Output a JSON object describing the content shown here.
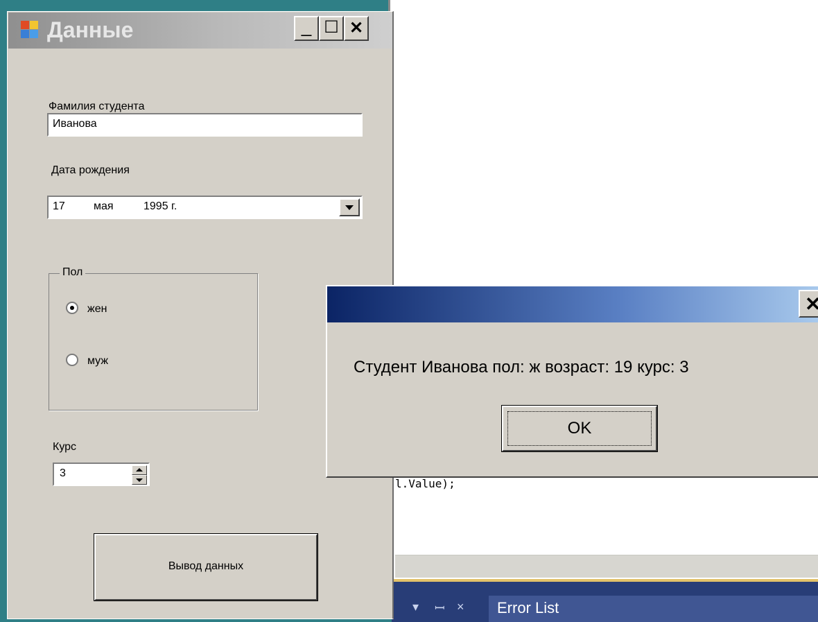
{
  "editor": {
    "code_fragment": "l.Value);"
  },
  "error_panel": {
    "tab_label": "Error List",
    "dropdown_glyph": "▾",
    "pin_glyph": "ꟷ",
    "close_glyph": "×"
  },
  "form": {
    "title": "Данные",
    "icon": "app-form-icon",
    "minimize_glyph": "_",
    "maximize_glyph": "☐",
    "close_glyph": "✕",
    "surname_label": "Фамилия студента",
    "surname_value": "Иванова",
    "birth_label": "Дата рождения",
    "birth_day": "17",
    "birth_month": "мая",
    "birth_year": "1995 г.",
    "gender_group_label": "Пол",
    "gender_options": [
      {
        "label": "жен",
        "checked": true
      },
      {
        "label": "муж",
        "checked": false
      }
    ],
    "course_label": "Курс",
    "course_value": "3",
    "output_button": "Вывод данных"
  },
  "message_box": {
    "text": "Студент Иванова пол: ж возраст: 19 курс: 3",
    "ok_button": "OK",
    "close_glyph": "✕"
  }
}
